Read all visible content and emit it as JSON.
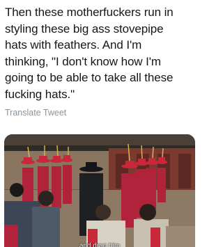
{
  "tweet": {
    "text_lines": [
      "Then these motherfuckers run in",
      "styling these big ass stovepipe",
      "hats with feathers. And I'm",
      "thinking, \"I don't know how I'm",
      "going to be able to take all these",
      "fucking hats.\""
    ],
    "translate_label": "Translate Tweet"
  },
  "media": {
    "description_icon": "video-still",
    "subtitle": "and drag him"
  },
  "colors": {
    "text": "#14171a",
    "muted": "#8a939b",
    "robe_red": "#b0233a",
    "hat_red": "#c8283a"
  }
}
